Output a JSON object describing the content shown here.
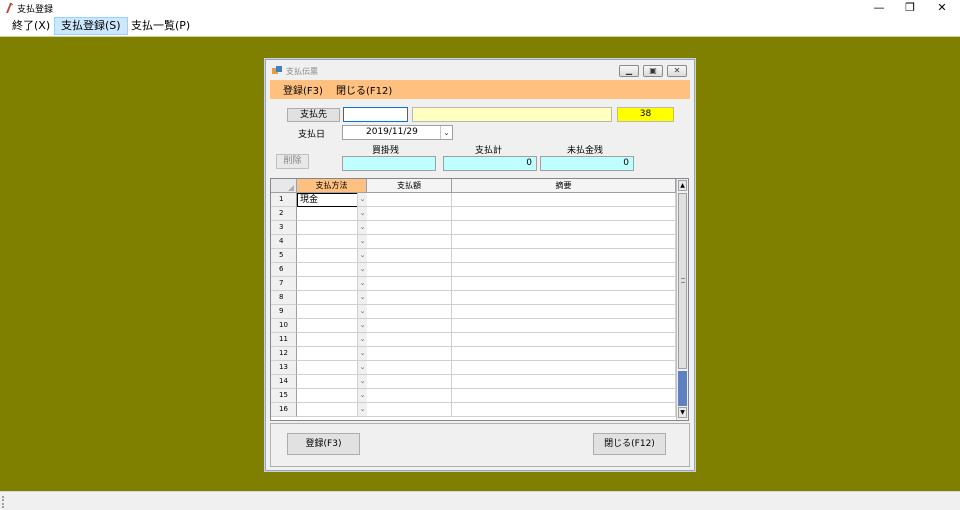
{
  "window": {
    "title": "支払登録",
    "minimize_glyph": "—",
    "restore_glyph": "❐",
    "close_glyph": "✕"
  },
  "menu": {
    "items": [
      "終了(X)",
      "支払登録(S)",
      "支払一覧(P)"
    ]
  },
  "dialog": {
    "title": "支払伝票",
    "menu": [
      "登録(F3)",
      "閉じる(F12)"
    ],
    "payee_button": "支払先",
    "payee_code": "",
    "payee_name": "",
    "payee_number": "38",
    "date_label": "支払日",
    "date_value": "2019/11/29",
    "delete_button": "削除",
    "summary_headers": [
      "買掛残",
      "支払計",
      "未払金残"
    ],
    "summary_values": [
      "",
      "0",
      "0"
    ],
    "grid": {
      "headers": [
        "支払方法",
        "支払額",
        "摘要"
      ],
      "row_numbers": [
        "1",
        "2",
        "3",
        "4",
        "5",
        "6",
        "7",
        "8",
        "9",
        "10",
        "11",
        "12",
        "13",
        "14",
        "15",
        "16"
      ],
      "first_row_method": "現金"
    },
    "register_button": "登録(F3)",
    "close_button": "閉じる(F12)"
  },
  "colors": {
    "workspace": "#808000",
    "dialog_menu": "#ffc080",
    "summary_field": "#c0ffff",
    "payee_name_field": "#ffffc0",
    "payee_number_field": "#ffff00"
  }
}
